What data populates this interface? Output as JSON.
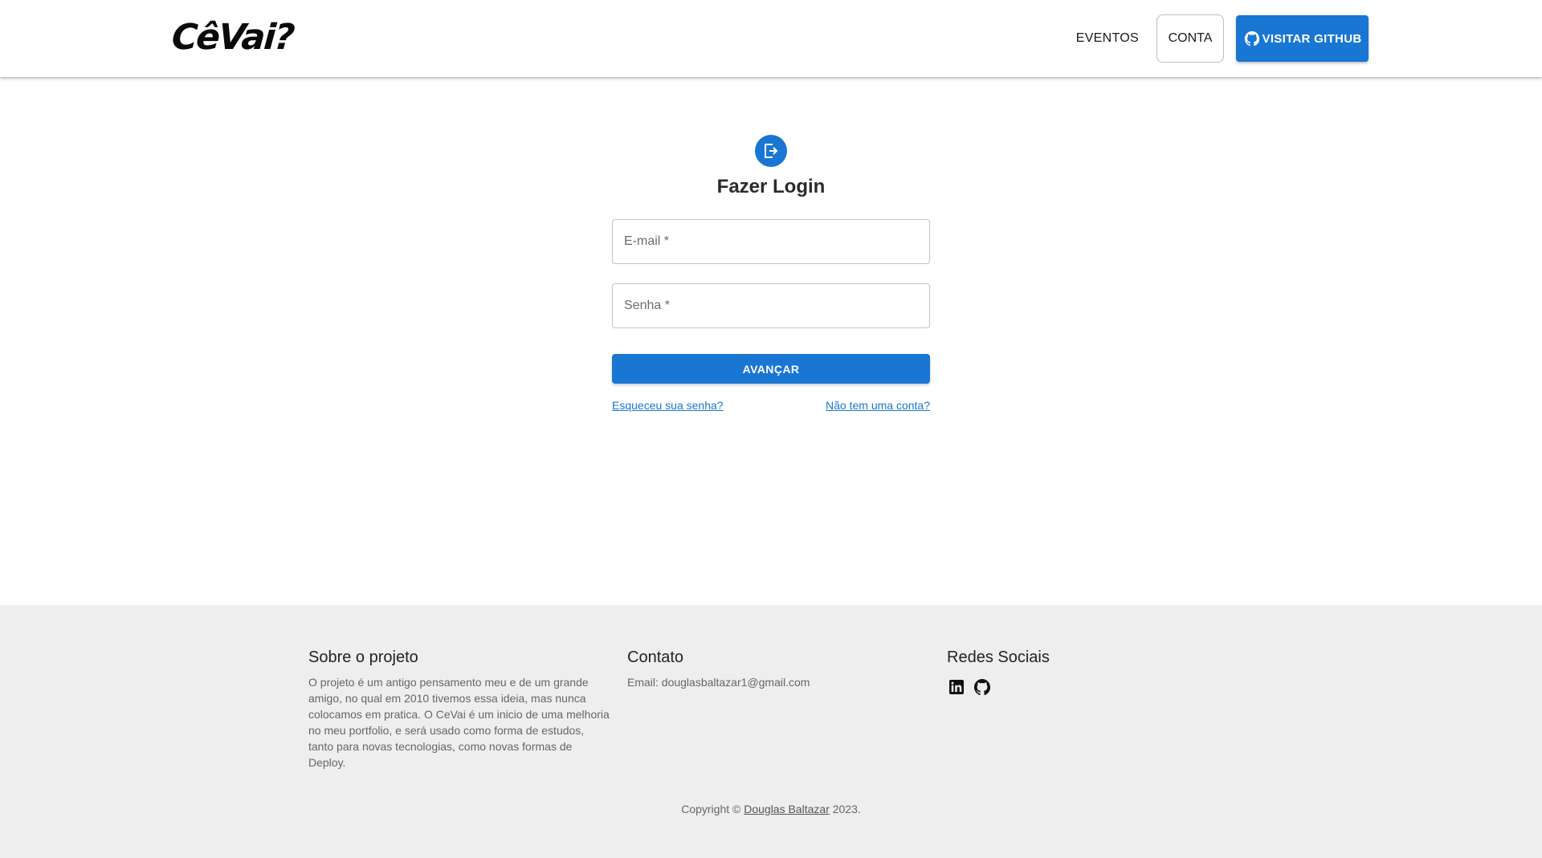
{
  "header": {
    "logo_text": "CêVai?",
    "nav": {
      "eventos": "EVENTOS",
      "conta": "CONTA",
      "github": "VISITAR GITHUB"
    }
  },
  "login": {
    "icon": "login-icon",
    "title": "Fazer Login",
    "email_label": "E-mail *",
    "password_label": "Senha *",
    "submit": "AVANÇAR",
    "forgot": "Esqueceu sua senha?",
    "signup": "Não tem uma conta?"
  },
  "footer": {
    "about": {
      "title": "Sobre o projeto",
      "text": "O projeto é um antigo pensamento meu e de um grande amigo, no qual em 2010 tivemos essa ideia, mas nunca colocamos em pratica. O CeVai é um inicio de uma melhoria no meu portfolio, e será usado como forma de estudos, tanto para novas tecnologias, como novas formas de Deploy."
    },
    "contact": {
      "title": "Contato",
      "email": "Email: douglasbaltazar1@gmail.com"
    },
    "social": {
      "title": "Redes Sociais",
      "icons": [
        "linkedin-icon",
        "github-icon"
      ]
    },
    "copyright": {
      "prefix": "Copyright ©",
      "author": "Douglas Baltazar",
      "year": "2023."
    }
  },
  "colors": {
    "primary": "#1976d2",
    "footer_bg": "#eeeeee"
  }
}
